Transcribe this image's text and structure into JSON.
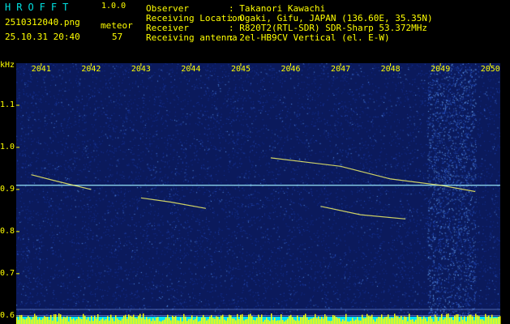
{
  "app": {
    "title": "HROFFT",
    "version": "1.0.0"
  },
  "file": {
    "name": "2510312040.png",
    "datetime": "25.10.31 20:40"
  },
  "meteor": {
    "label": "meteor",
    "count": "57"
  },
  "info": [
    {
      "key": "Observer",
      "value": ": Takanori Kawachi"
    },
    {
      "key": "Receiving Location",
      "value": ": Ogaki, Gifu, JAPAN (136.60E, 35.35N)"
    },
    {
      "key": "Receiver",
      "value": ": R820T2(RTL-SDR) SDR-Sharp 53.372MHz"
    },
    {
      "key": "Receiving antenna",
      "value": ": 2el-HB9CV Vertical (el. E-W)"
    }
  ],
  "colors": {
    "text": "#ffff00",
    "title": "#00e0e0",
    "background": "#0b1a5c",
    "trace": "#ffff66"
  },
  "chart_data": {
    "type": "heatmap",
    "yunit": "kHz",
    "ylim": [
      0.59,
      1.2
    ],
    "yticks": [
      "1.1",
      "1.0",
      "0.9",
      "0.8",
      "0.7",
      "0.6"
    ],
    "ytick_values": [
      1.1,
      1.0,
      0.9,
      0.8,
      0.7,
      0.6
    ],
    "xlim": [
      2040.5,
      2050.2
    ],
    "xticks": [
      "2041",
      "2042",
      "2043",
      "2044",
      "2045",
      "2046",
      "2047",
      "2048",
      "2049",
      "2050"
    ],
    "xtick_values": [
      2041,
      2042,
      2043,
      2044,
      2045,
      2046,
      2047,
      2048,
      2049,
      2050
    ],
    "carrier_khz": 0.91,
    "traces": [
      {
        "x": [
          2045.6,
          2047.0,
          2048.0,
          2049.0,
          2049.7
        ],
        "y": [
          0.975,
          0.955,
          0.925,
          0.91,
          0.895
        ]
      },
      {
        "x": [
          2043.0,
          2043.6,
          2044.3
        ],
        "y": [
          0.88,
          0.87,
          0.855
        ]
      },
      {
        "x": [
          2040.8,
          2041.3,
          2042.0
        ],
        "y": [
          0.935,
          0.92,
          0.9
        ]
      },
      {
        "x": [
          2046.6,
          2047.4,
          2048.3
        ],
        "y": [
          0.86,
          0.84,
          0.83
        ]
      }
    ]
  }
}
